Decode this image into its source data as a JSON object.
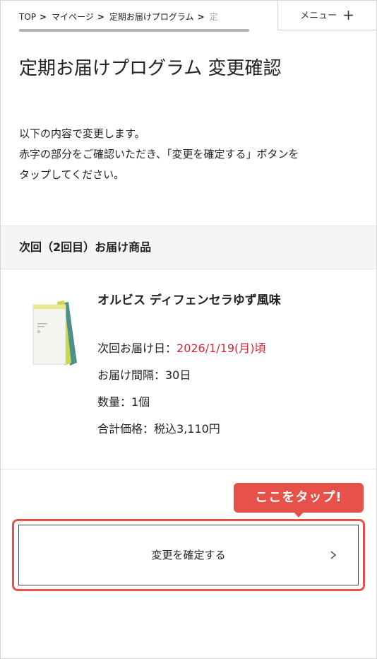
{
  "breadcrumb": {
    "items": [
      "TOP",
      "マイページ",
      "定期お届けプログラム",
      "定"
    ],
    "separator": ">"
  },
  "menu": {
    "label": "メニュー",
    "icon": "plus-icon"
  },
  "page": {
    "title": "定期お届けプログラム 変更確認",
    "intro_line1": "以下の内容で変更します。",
    "intro_line2": "赤字の部分をご確認いただき、「変更を確定する」ボタンを",
    "intro_line3": "タップしてください。"
  },
  "section": {
    "header": "次回（2回目）お届け商品"
  },
  "product": {
    "name": "オルビス ディフェンセラゆず風味",
    "next_delivery_label": "次回お届け日：",
    "next_delivery_value": "2026/1/19(月)頃",
    "interval": "お届け間隔：30日",
    "quantity": "数量：1個",
    "total": "合計価格：税込3,110円"
  },
  "callout": {
    "text": "ここをタップ!"
  },
  "confirm": {
    "label": "変更を確定する",
    "icon": "chevron-right-icon"
  },
  "colors": {
    "accent": "#e8514a",
    "highlight_text": "#d22838",
    "section_bg": "#f5f5f5"
  }
}
